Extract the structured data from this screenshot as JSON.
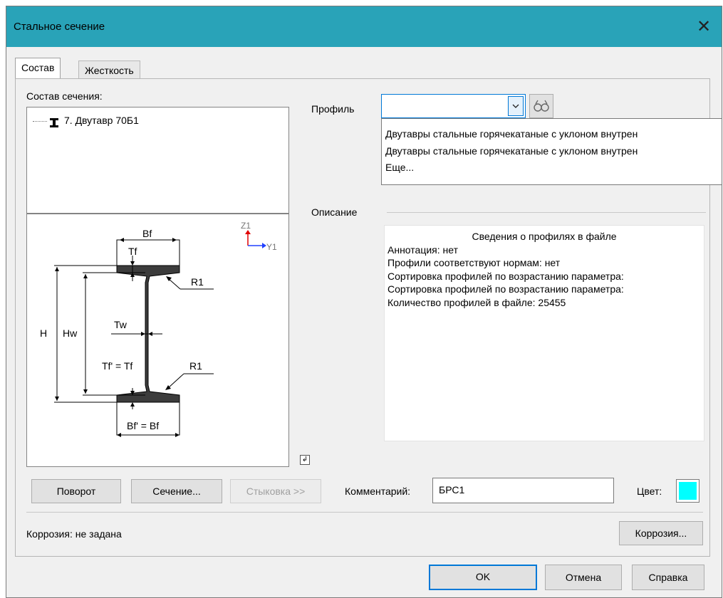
{
  "window": {
    "title": "Стальное сечение",
    "close_glyph": "✕"
  },
  "tabs": [
    {
      "label": "Состав",
      "active": true
    },
    {
      "label": "Жесткость",
      "active": false
    }
  ],
  "composition": {
    "label": "Состав сечения:",
    "items": [
      {
        "icon": "i-beam-icon",
        "text": "7. Двутавр 70Б1"
      }
    ]
  },
  "drawing": {
    "axis_z": "Z1",
    "axis_y": "Y1",
    "bf": "Bf",
    "tf": "Tf",
    "r1_top": "R1",
    "h": "H",
    "hw": "Hw",
    "tw": "Tw",
    "tf2": "Tf' = Tf",
    "r1_bottom": "R1",
    "bf2": "Bf'  =  Bf"
  },
  "profile": {
    "label": "Профиль",
    "value": "",
    "dropdown": [
      "Двутавры стальные горячекатаные с уклоном внутрен",
      "Двутавры стальные горячекатаные с уклоном внутрен",
      "Еще..."
    ]
  },
  "description": {
    "label": "Описание",
    "heading": "Сведения о профилях в файле",
    "lines": [
      "Аннотация: нет",
      "Профили соответствуют нормам: нет",
      "Сортировка профилей по возрастанию параметра:",
      "Сортировка профилей по возрастанию параметра:",
      "Количество профилей в файле: 25455"
    ]
  },
  "buttons": {
    "rotate": "Поворот",
    "section": "Сечение...",
    "joint": "Стыковка >>",
    "corrosion": "Коррозия...",
    "ok": "OK",
    "cancel": "Отмена",
    "help": "Справка"
  },
  "comment": {
    "label": "Комментарий:",
    "value": "БРС1"
  },
  "color": {
    "label": "Цвет:",
    "value": "#00ffff"
  },
  "corrosion_status": "Коррозия: не задана",
  "colors": {
    "titlebar": "#29a3b8",
    "accent": "#0078d7",
    "swatch": "#00ffff"
  }
}
